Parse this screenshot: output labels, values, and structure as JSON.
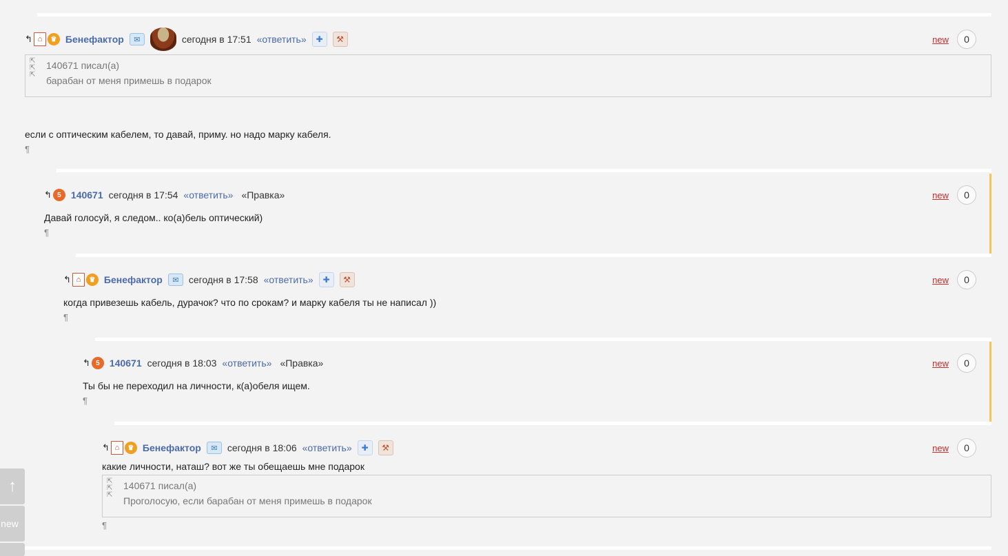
{
  "comments": [
    {
      "user": "Бенефактор",
      "date": "сегодня в 17:51",
      "reply": "«ответить»",
      "new": "new",
      "count": "0",
      "quote_author": "140671 писал(а)",
      "quote_text": "барабан от меня примешь в подарок",
      "text": "если с оптическим кабелем, то давай, приму. но надо марку кабеля."
    },
    {
      "user": "140671",
      "date": "сегодня в 17:54",
      "reply": "«ответить»",
      "edit": "«Правка»",
      "new": "new",
      "count": "0",
      "text": "Давай голосуй, я следом.. ко(а)бель оптический)"
    },
    {
      "user": "Бенефактор",
      "date": "сегодня в 17:58",
      "reply": "«ответить»",
      "new": "new",
      "count": "0",
      "text": "когда привезешь кабель, дурачок? что по срокам? и марку кабеля ты не написал ))"
    },
    {
      "user": "140671",
      "date": "сегодня в 18:03",
      "reply": "«ответить»",
      "edit": "«Правка»",
      "new": "new",
      "count": "0",
      "text": "Ты бы не переходил на личности, к(а)обеля ищем."
    },
    {
      "user": "Бенефактор",
      "date": "сегодня в 18:06",
      "reply": "«ответить»",
      "new": "new",
      "count": "0",
      "text": "какие личности, наташ? вот же ты обещаешь мне подарок",
      "quote_author": "140671 писал(а)",
      "quote_text": "Проголосую, если барабан от меня примешь в подарок"
    }
  ],
  "pilcrow": "¶",
  "side": {
    "up_icon": "arrow-up-icon",
    "new_label": "new"
  }
}
